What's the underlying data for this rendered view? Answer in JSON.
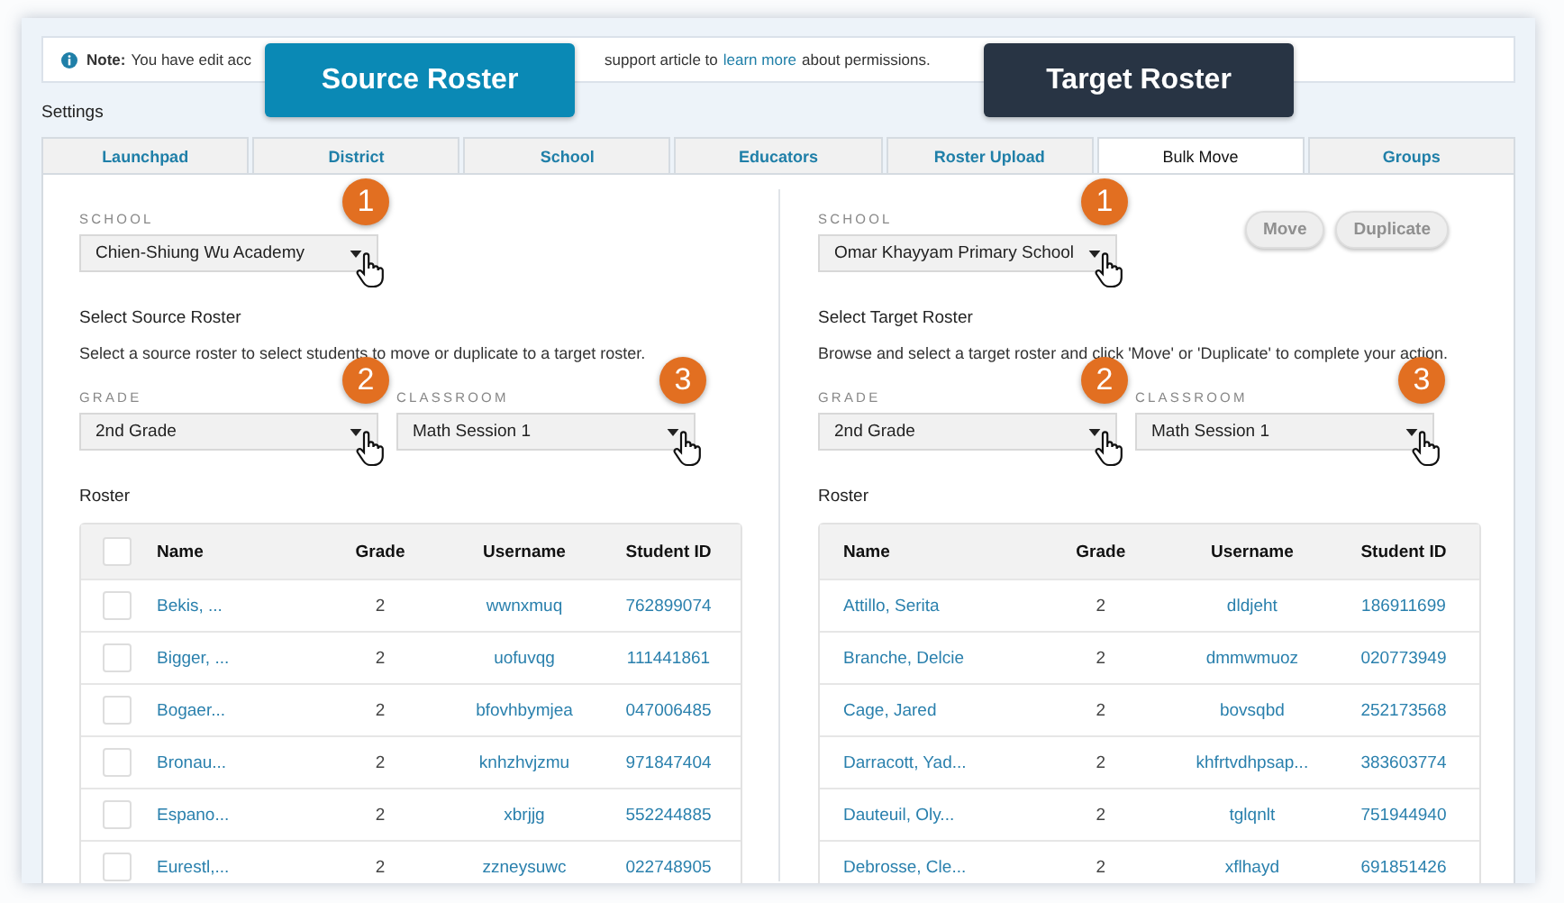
{
  "note": {
    "label": "Note:",
    "text_start": "You have edit acc",
    "text_end": "support article to",
    "link": "learn more",
    "text_tail": "about permissions."
  },
  "callouts": [
    {
      "label": "Source Roster",
      "kind": "source"
    },
    {
      "label": "Target Roster",
      "kind": "target"
    }
  ],
  "section_title": "Settings",
  "tabs": [
    {
      "label": "Launchpad",
      "selected": false
    },
    {
      "label": "District",
      "selected": false
    },
    {
      "label": "School",
      "selected": false
    },
    {
      "label": "Educators",
      "selected": false
    },
    {
      "label": "Roster Upload",
      "selected": false
    },
    {
      "label": "Bulk Move",
      "selected": true
    },
    {
      "label": "Groups",
      "selected": false
    }
  ],
  "panels": [
    {
      "school": {
        "label": "SCHOOL",
        "value": "Chien-Shiung Wu Academy",
        "step": "1"
      },
      "heading": "Select Source Roster",
      "description": "Select a source roster to select students to move or duplicate to a target roster.",
      "grade": {
        "label": "GRADE",
        "value": "2nd Grade",
        "step": "2"
      },
      "classroom": {
        "label": "CLASSROOM",
        "value": "Math Session 1",
        "step": "3"
      },
      "roster_label": "Roster",
      "table": {
        "select_all": {
          "checked": false
        },
        "columns": [
          "Name",
          "Grade",
          "Username",
          "Student ID"
        ],
        "rows": [
          {
            "checked": false,
            "cells": [
              "Bekis, ...",
              "2",
              "wwnxmuq",
              "762899074"
            ]
          },
          {
            "checked": false,
            "cells": [
              "Bigger, ...",
              "2",
              "uofuvqg",
              "111441861"
            ]
          },
          {
            "checked": false,
            "cells": [
              "Bogaer...",
              "2",
              "bfovhbymjea",
              "047006485"
            ]
          },
          {
            "checked": false,
            "cells": [
              "Bronau...",
              "2",
              "knhzhvjzmu",
              "971847404"
            ]
          },
          {
            "checked": false,
            "cells": [
              "Espano...",
              "2",
              "xbrjjg",
              "552244885"
            ]
          },
          {
            "checked": false,
            "cells": [
              "Eurestl,...",
              "2",
              "zzneysuwc",
              "022748905"
            ]
          }
        ]
      }
    },
    {
      "school": {
        "label": "SCHOOL",
        "value": "Omar Khayyam Primary School",
        "step": "1"
      },
      "buttons": [
        {
          "label": "Move",
          "disabled": true
        },
        {
          "label": "Duplicate",
          "disabled": true
        }
      ],
      "heading": "Select Target Roster",
      "description": "Browse and select a target roster and click 'Move' or 'Duplicate' to complete your action.",
      "grade": {
        "label": "GRADE",
        "value": "2nd Grade",
        "step": "2"
      },
      "classroom": {
        "label": "CLASSROOM",
        "value": "Math Session 1",
        "step": "3"
      },
      "roster_label": "Roster",
      "table": {
        "columns": [
          "Name",
          "Grade",
          "Username",
          "Student ID"
        ],
        "rows": [
          {
            "cells": [
              "Attillo, Serita",
              "2",
              "dldjeht",
              "186911699"
            ]
          },
          {
            "cells": [
              "Branche, Delcie",
              "2",
              "dmmwmuoz",
              "020773949"
            ]
          },
          {
            "cells": [
              "Cage, Jared",
              "2",
              "bovsqbd",
              "252173568"
            ]
          },
          {
            "cells": [
              "Darracott, Yad...",
              "2",
              "khfrtvdhpsap...",
              "383603774"
            ]
          },
          {
            "cells": [
              "Dauteuil, Oly...",
              "2",
              "tglqnlt",
              "751944940"
            ]
          },
          {
            "cells": [
              "Debrosse, Cle...",
              "2",
              "xflhayd",
              "691851426"
            ]
          }
        ]
      }
    }
  ]
}
